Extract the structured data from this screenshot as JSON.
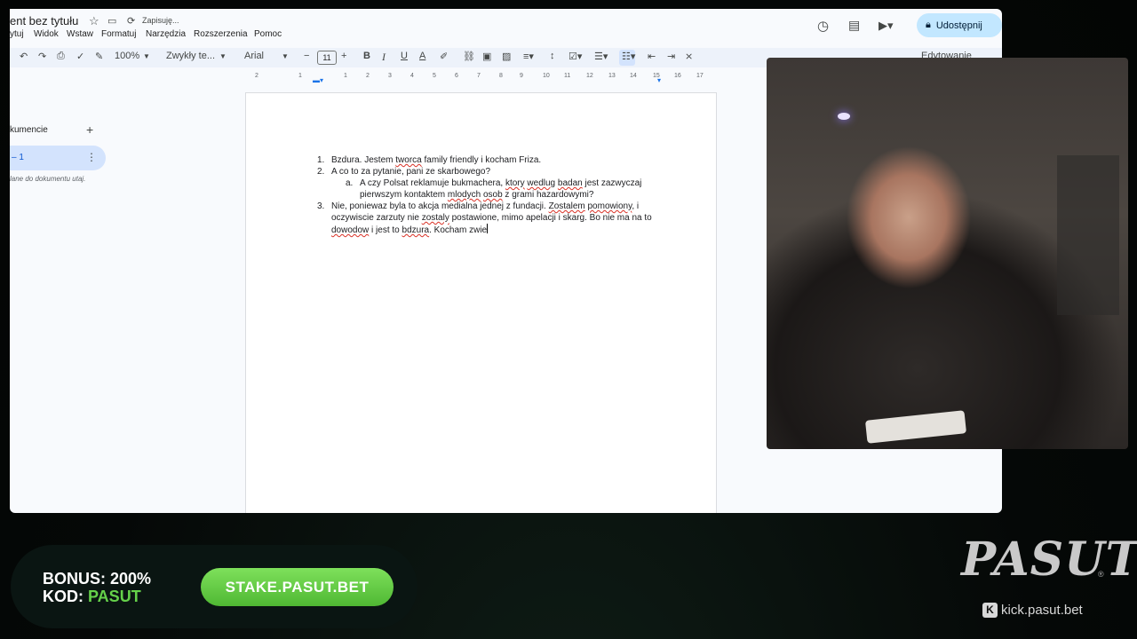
{
  "docs": {
    "title": "ent bez tytułu",
    "saving": "Zapisuję...",
    "menu": [
      "ytuj",
      "Widok",
      "Wstaw",
      "Formatuj",
      "Narzędzia",
      "Rozszerzenia",
      "Pomoc"
    ],
    "share_label": "Udostępnij",
    "edit_mode": "Edytowanie",
    "toolbar": {
      "zoom": "100%",
      "style": "Zwykły te...",
      "font": "Arial",
      "font_size": "11"
    },
    "ruler_ticks": [
      "2",
      "1",
      "1",
      "2",
      "3",
      "4",
      "5",
      "6",
      "7",
      "8",
      "9",
      "10",
      "11",
      "12",
      "13",
      "14",
      "15",
      "16",
      "17",
      "18"
    ],
    "sidebar": {
      "heading": "kumencie",
      "item_label": "– 1",
      "note": "lane do dokumentu utaj."
    },
    "body": {
      "item1": {
        "num": "1.",
        "parts": [
          "Bzdura. Jestem ",
          "tworca",
          " family friendly i kocham Friza."
        ]
      },
      "item2": {
        "num": "2.",
        "text": "A co to za pytanie, pani ze skarbowego?"
      },
      "item2a": {
        "num": "a.",
        "parts": [
          "A czy Polsat reklamuje bukmachera, ",
          "ktory",
          " ",
          "wedlug",
          " ",
          "badan",
          " jest zazwyczaj pierwszym kontaktem ",
          "mlodych",
          " ",
          "osob",
          " z grami hazardowymi?"
        ]
      },
      "item3": {
        "num": "3.",
        "parts": [
          "Nie, poniewaz byla to akcja medialna jednej z fundacji. ",
          "Zostalem",
          " ",
          "pomowiony",
          ", i oczywiscie zarzuty nie ",
          "zostaly",
          " postawione, mimo apelacji i skarg. Bo nie ma na to ",
          "dowodow",
          " i jest to ",
          "bdzura",
          ". Kocham zwie"
        ]
      }
    }
  },
  "banner": {
    "bonus_label": "BONUS:",
    "bonus_value": "200%",
    "code_label": "KOD:",
    "code_value": "PASUT",
    "button": "STAKE.PASUT.BET"
  },
  "brand": {
    "logo": "PASUT",
    "registered": "®",
    "kick_url": "kick.pasut.bet",
    "kick_icon": "K"
  },
  "colors": {
    "share_bg": "#c2e7ff",
    "accent_green": "#65d14a",
    "spell_underline": "#d93025"
  }
}
